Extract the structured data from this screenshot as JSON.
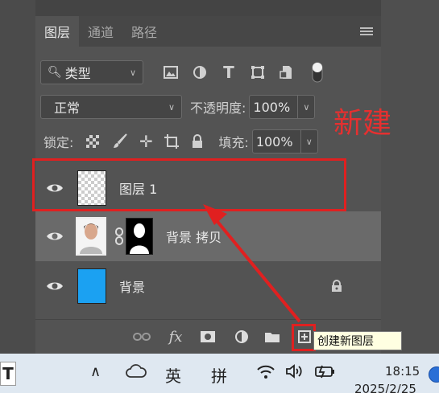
{
  "tabs": [
    "图层",
    "通道",
    "路径"
  ],
  "filter": {
    "label": "类型"
  },
  "blend_mode": "正常",
  "opacity": {
    "label": "不透明度:",
    "value": "100%"
  },
  "lock_label": "锁定:",
  "fill": {
    "label": "填充:",
    "value": "100%"
  },
  "layers": [
    {
      "name": "图层 1"
    },
    {
      "name": "背景 拷贝"
    },
    {
      "name": "背景"
    }
  ],
  "annotation": "新建",
  "tooltip": "创建新图层",
  "taskbar": {
    "ime_lang": "英",
    "ime_mode": "拼",
    "time": "18:15",
    "date": "2025/2/25"
  },
  "colors": {
    "highlight": "#e02020",
    "bg_layer": "#1ba1f2",
    "tooltip_bg": "#ffffe1"
  }
}
